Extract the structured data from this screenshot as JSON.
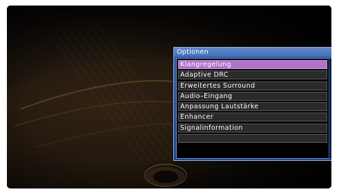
{
  "menu": {
    "title": "Optionen",
    "items": [
      {
        "label": "Klangregelung",
        "selected": true
      },
      {
        "label": "Adaptive DRC",
        "selected": false
      },
      {
        "label": "Erweitertes Surround",
        "selected": false
      },
      {
        "label": "Audio–Eingang",
        "selected": false
      },
      {
        "label": "Anpassung Lautstärke",
        "selected": false
      },
      {
        "label": "Enhancer",
        "selected": false
      },
      {
        "label": "Signalinformation",
        "selected": false
      },
      {
        "label": "",
        "selected": false
      }
    ]
  },
  "colors": {
    "menu_frame": "#2d5fb0",
    "title_bar": "#4470b8",
    "selected_item": "#b073c9",
    "item_background": "#2a2a2a"
  }
}
